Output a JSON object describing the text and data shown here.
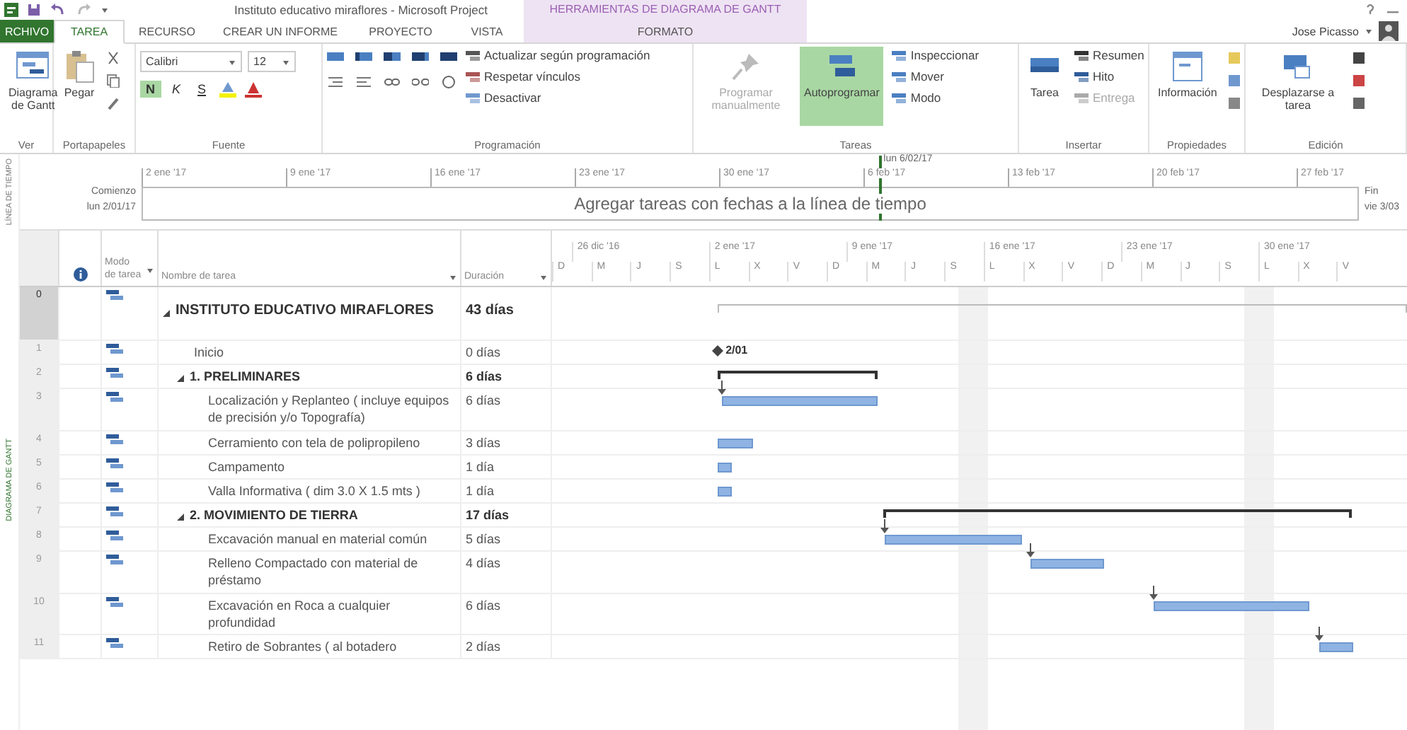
{
  "window": {
    "title": "Instituto educativo miraflores - Microsoft Project",
    "context_group": "HERRAMIENTAS DE DIAGRAMA DE GANTT",
    "user": "Jose Picasso"
  },
  "tabs": [
    {
      "label": "RCHIVO",
      "kind": "file",
      "selected": false
    },
    {
      "label": "TAREA",
      "kind": "tab",
      "selected": true
    },
    {
      "label": "RECURSO",
      "kind": "tab",
      "selected": false
    },
    {
      "label": "CREAR UN INFORME",
      "kind": "tab",
      "selected": false
    },
    {
      "label": "PROYECTO",
      "kind": "tab",
      "selected": false
    },
    {
      "label": "VISTA",
      "kind": "tab",
      "selected": false
    },
    {
      "label": "FORMATO",
      "kind": "context",
      "selected": false
    }
  ],
  "ribbon": [
    {
      "label": "Ver",
      "controls": [
        {
          "kind": "large",
          "label": "Diagrama de Gantt",
          "disabled": false,
          "selected": false
        }
      ]
    },
    {
      "label": "Portapapeles",
      "controls": [
        {
          "kind": "large",
          "label": "Pegar",
          "disabled": false,
          "selected": false
        }
      ]
    },
    {
      "label": "Fuente",
      "controls": [
        {
          "kind": "font",
          "font": "Calibri",
          "size": "12",
          "bold": "N",
          "italic": "K",
          "underline": "S"
        }
      ]
    },
    {
      "label": "Programación",
      "controls": [
        {
          "kind": "small",
          "label": "Actualizar según programación",
          "disabled": false
        },
        {
          "kind": "small",
          "label": "Respetar vínculos",
          "disabled": false
        },
        {
          "kind": "small",
          "label": "Desactivar",
          "disabled": false
        }
      ]
    },
    {
      "label": "Tareas",
      "controls": [
        {
          "kind": "large",
          "label": "Programar manualmente",
          "disabled": true,
          "selected": false
        },
        {
          "kind": "large",
          "label": "Autoprogramar",
          "disabled": false,
          "selected": true
        },
        {
          "kind": "small",
          "label": "Inspeccionar",
          "disabled": false
        },
        {
          "kind": "small",
          "label": "Mover",
          "disabled": false
        },
        {
          "kind": "small",
          "label": "Modo",
          "disabled": false
        }
      ]
    },
    {
      "label": "Insertar",
      "controls": [
        {
          "kind": "large",
          "label": "Tarea",
          "disabled": false,
          "selected": false
        },
        {
          "kind": "small",
          "label": "Resumen",
          "disabled": false
        },
        {
          "kind": "small",
          "label": "Hito",
          "disabled": false
        },
        {
          "kind": "small",
          "label": "Entrega",
          "disabled": true
        }
      ]
    },
    {
      "label": "Propiedades",
      "controls": [
        {
          "kind": "large",
          "label": "Información",
          "disabled": false,
          "selected": false
        }
      ]
    },
    {
      "label": "Edición",
      "controls": [
        {
          "kind": "large",
          "label": "Desplazarse a tarea",
          "disabled": false,
          "selected": false
        }
      ]
    }
  ],
  "timeline": {
    "side_label": "LÍNEA DE TIEMPO",
    "start_label": "Comienzo",
    "start_date": "lun 2/01/17",
    "end_label": "Fin",
    "end_date": "vie 3/03",
    "placeholder": "Agregar tareas con fechas a la línea de tiempo",
    "ticks": [
      "2 ene '17",
      "9 ene '17",
      "16 ene '17",
      "23 ene '17",
      "30 ene '17",
      "6 feb '17",
      "13 feb '17",
      "20 feb '17",
      "27 feb '17"
    ],
    "today": "lun 6/02/17"
  },
  "view_label": "DIAGRAMA DE GANTT",
  "columns": {
    "mode": "Modo de tarea",
    "name": "Nombre de tarea",
    "duration": "Duración"
  },
  "timescale": {
    "weeks": [
      "26 dic '16",
      "2 ene '17",
      "9 ene '17",
      "16 ene '17",
      "23 ene '17",
      "30 ene '17"
    ],
    "days": [
      "D",
      "M",
      "J",
      "S",
      "L",
      "X",
      "V",
      "D",
      "M",
      "J",
      "S",
      "L",
      "X",
      "V",
      "D",
      "M",
      "J",
      "S",
      "L",
      "X",
      "V"
    ]
  },
  "tasks": [
    {
      "id": "0",
      "name": "INSTITUTO EDUCATIVO MIRAFLORES",
      "duration": "43 días",
      "kind": "summary",
      "expanded": true,
      "selected": true,
      "children": [
        {
          "id": "1",
          "name": "Inicio",
          "duration": "0 días",
          "kind": "milestone",
          "selected": false,
          "milestone_label": "2/01"
        },
        {
          "id": "2",
          "name": "1. PRELIMINARES",
          "duration": "6 días",
          "kind": "summary",
          "expanded": true,
          "selected": false,
          "children": [
            {
              "id": "3",
              "name": "Localización y Replanteo ( incluye equipos de precisión y/o Topografía)",
              "duration": "6 días",
              "kind": "task",
              "selected": false
            },
            {
              "id": "4",
              "name": "Cerramiento con tela de polipropileno",
              "duration": "3 días",
              "kind": "task",
              "selected": false
            },
            {
              "id": "5",
              "name": "Campamento",
              "duration": "1 día",
              "kind": "task",
              "selected": false
            },
            {
              "id": "6",
              "name": "Valla Informativa ( dim 3.0 X 1.5 mts )",
              "duration": "1 día",
              "kind": "task",
              "selected": false
            }
          ]
        },
        {
          "id": "7",
          "name": "2. MOVIMIENTO DE TIERRA",
          "duration": "17 días",
          "kind": "summary",
          "expanded": true,
          "selected": false,
          "children": [
            {
              "id": "8",
              "name": "Excavación manual en material común",
              "duration": "5 días",
              "kind": "task",
              "selected": false
            },
            {
              "id": "9",
              "name": "Relleno Compactado con material de préstamo",
              "duration": "4 días",
              "kind": "task",
              "selected": false
            },
            {
              "id": "10",
              "name": "Excavación en Roca a cualquier profundidad",
              "duration": "6 días",
              "kind": "task",
              "selected": false
            },
            {
              "id": "11",
              "name": "Retiro de Sobrantes ( al botadero",
              "duration": "2 días",
              "kind": "task",
              "selected": false
            }
          ]
        }
      ]
    }
  ]
}
